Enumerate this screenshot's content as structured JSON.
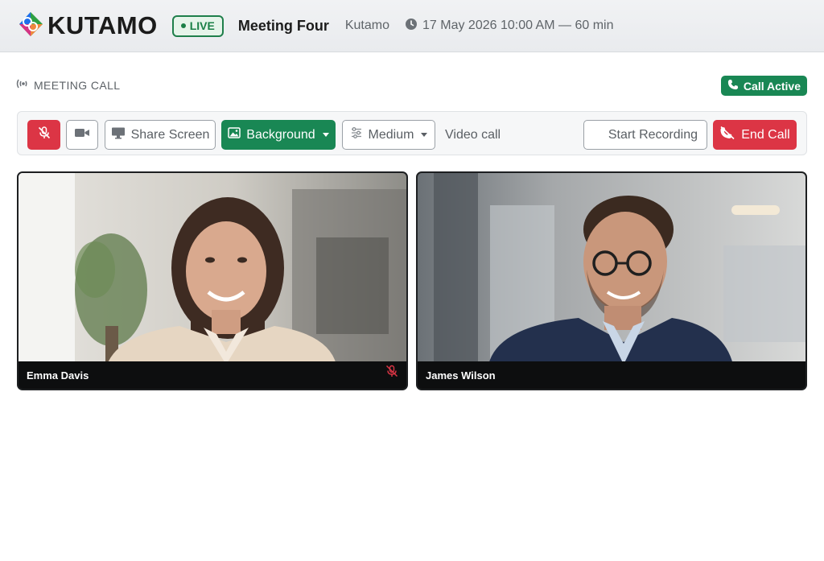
{
  "app": {
    "brand": "KUTAMO",
    "live_label": "LIVE",
    "meeting_title": "Meeting Four",
    "organization": "Kutamo",
    "schedule": "17 May 2026 10:00 AM — 60 min"
  },
  "section": {
    "label": "MEETING CALL",
    "status": "Call Active"
  },
  "toolbar": {
    "share_label": "Share Screen",
    "background_label": "Background",
    "quality_label": "Medium",
    "mode_text": "Video call",
    "record_label": "Start Recording",
    "end_label": "End Call"
  },
  "participants": [
    {
      "name": "Emma Davis",
      "muted": true
    },
    {
      "name": "James Wilson",
      "muted": false
    }
  ],
  "colors": {
    "danger": "#dc3545",
    "success": "#198754",
    "live_border": "#1f7f4b"
  },
  "icons": [
    "kutamo-logo-icon",
    "live-dot-icon",
    "clock-icon",
    "signal-icon",
    "phone-icon",
    "mic-off-icon",
    "video-icon",
    "monitor-icon",
    "image-icon",
    "sliders-icon",
    "phone-hangup-icon"
  ]
}
